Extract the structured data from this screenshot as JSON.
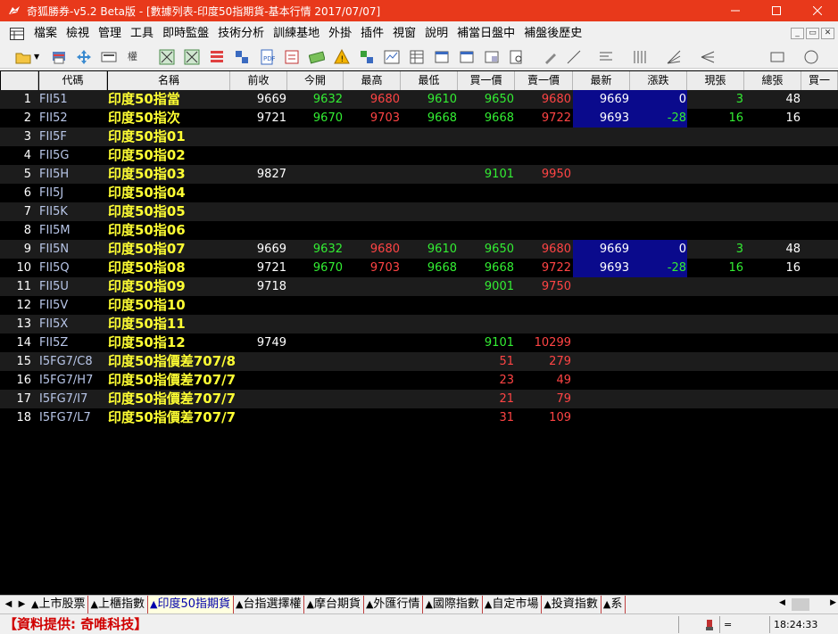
{
  "window": {
    "title": "奇狐勝券-v5.2 Beta版 - [數據列表-印度50指期貨-基本行情 2017/07/07]",
    "minimize": "─",
    "maximize": "☐",
    "close": "✕"
  },
  "menu": {
    "items": [
      "檔案",
      "檢視",
      "管理",
      "工具",
      "即時監盤",
      "技術分析",
      "訓練基地",
      "外掛",
      "插件",
      "視窗",
      "說明",
      "補當日盤中",
      "補盤後歷史"
    ],
    "mdi": [
      "_",
      "▭",
      "✕"
    ]
  },
  "columns": [
    "代碼",
    "名稱",
    "前收",
    "今開",
    "最高",
    "最低",
    "買一價",
    "賣一價",
    "最新",
    "漲跌",
    "現張",
    "總張",
    "買一"
  ],
  "rows": [
    {
      "idx": "1",
      "code": "FII51",
      "name": "印度50指當",
      "prev": "9669",
      "open": "9632",
      "high": "9680",
      "low": "9610",
      "bid": "9650",
      "ask": "9680",
      "last": "9669",
      "chg": "0",
      "vol": "3",
      "total": "48"
    },
    {
      "idx": "2",
      "code": "FII52",
      "name": "印度50指次",
      "prev": "9721",
      "open": "9670",
      "high": "9703",
      "low": "9668",
      "bid": "9668",
      "ask": "9722",
      "last": "9693",
      "chg": "-28",
      "vol": "16",
      "total": "16"
    },
    {
      "idx": "3",
      "code": "FII5F",
      "name": "印度50指01"
    },
    {
      "idx": "4",
      "code": "FII5G",
      "name": "印度50指02"
    },
    {
      "idx": "5",
      "code": "FII5H",
      "name": "印度50指03",
      "prev": "9827",
      "bid": "9101",
      "ask": "9950"
    },
    {
      "idx": "6",
      "code": "FII5J",
      "name": "印度50指04"
    },
    {
      "idx": "7",
      "code": "FII5K",
      "name": "印度50指05"
    },
    {
      "idx": "8",
      "code": "FII5M",
      "name": "印度50指06"
    },
    {
      "idx": "9",
      "code": "FII5N",
      "name": "印度50指07",
      "prev": "9669",
      "open": "9632",
      "high": "9680",
      "low": "9610",
      "bid": "9650",
      "ask": "9680",
      "last": "9669",
      "chg": "0",
      "vol": "3",
      "total": "48"
    },
    {
      "idx": "10",
      "code": "FII5Q",
      "name": "印度50指08",
      "prev": "9721",
      "open": "9670",
      "high": "9703",
      "low": "9668",
      "bid": "9668",
      "ask": "9722",
      "last": "9693",
      "chg": "-28",
      "vol": "16",
      "total": "16"
    },
    {
      "idx": "11",
      "code": "FII5U",
      "name": "印度50指09",
      "prev": "9718",
      "bid": "9001",
      "ask": "9750"
    },
    {
      "idx": "12",
      "code": "FII5V",
      "name": "印度50指10"
    },
    {
      "idx": "13",
      "code": "FII5X",
      "name": "印度50指11"
    },
    {
      "idx": "14",
      "code": "FII5Z",
      "name": "印度50指12",
      "prev": "9749",
      "bid": "9101",
      "ask": "10299"
    },
    {
      "idx": "15",
      "code": "I5FG7/C8",
      "name": "印度50指價差707/8",
      "bid": "51",
      "ask": "279"
    },
    {
      "idx": "16",
      "code": "I5FG7/H7",
      "name": "印度50指價差707/7",
      "bid": "23",
      "ask": "49"
    },
    {
      "idx": "17",
      "code": "I5FG7/I7",
      "name": "印度50指價差707/7",
      "bid": "21",
      "ask": "79"
    },
    {
      "idx": "18",
      "code": "I5FG7/L7",
      "name": "印度50指價差707/7",
      "bid": "31",
      "ask": "109"
    }
  ],
  "tabs": [
    "上市股票",
    "上櫃指數",
    "印度50指期貨",
    "台指選擇權",
    "摩台期貨",
    "外匯行情",
    "國際指數",
    "自定市場",
    "投資指數",
    "系"
  ],
  "active_tab": "印度50指期貨",
  "status": {
    "credit": "【資料提供: 奇唯科技】",
    "sep": "=",
    "time": "18:24:33"
  },
  "colors": {
    "titlebar": "#e8391b",
    "grid_bg": "#000000",
    "name_text": "#ffff33",
    "up": "#ff4444",
    "down": "#33ee33",
    "highlight": "#0a0a8c"
  },
  "icons": {
    "app": "fox-icon",
    "toolbar": [
      "open-folder-icon",
      "print-icon",
      "move-icon",
      "layout-icon",
      "weight-icon",
      "chart-x-icon",
      "chart-x2-icon",
      "list-icon",
      "grouping-icon",
      "document-icon",
      "note-icon",
      "money-icon",
      "warning-icon",
      "exchange-icon",
      "line-chart-icon",
      "table-icon",
      "window-icon",
      "window2-icon",
      "window3-icon",
      "search-doc-icon",
      "pencil-icon",
      "line-tool-icon",
      "text-lines-icon",
      "vertical-lines-icon",
      "fan-lines-icon",
      "pitchfork-icon",
      "rectangle-icon",
      "circle-icon"
    ]
  }
}
